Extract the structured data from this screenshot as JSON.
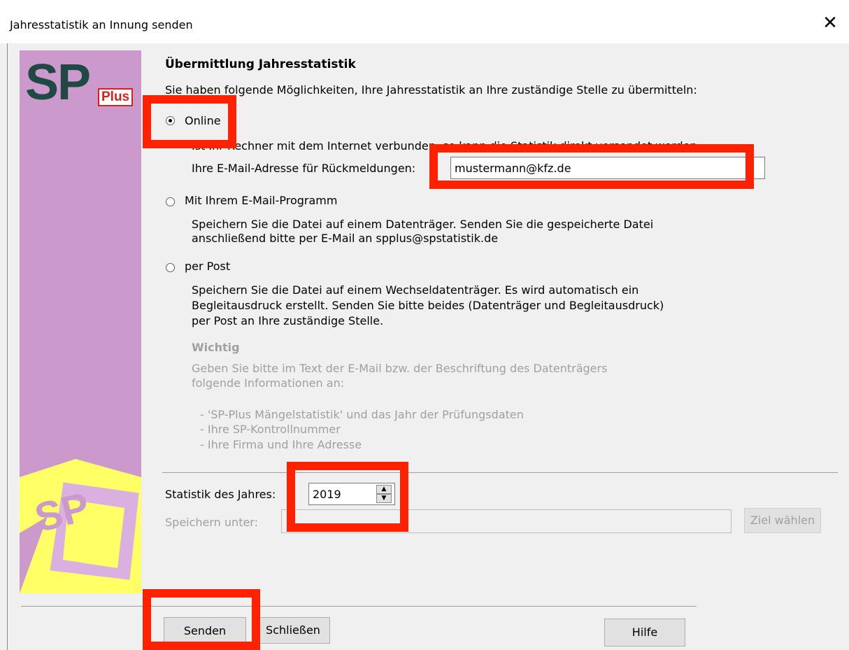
{
  "window": {
    "title": "Jahresstatistik an Innung senden",
    "close": "✕"
  },
  "logo": {
    "sp": "SP",
    "plus": "Plus",
    "small": "SP"
  },
  "heading": "Übermittlung Jahresstatistik",
  "intro": "Sie haben folgende Möglichkeiten, Ihre Jahresstatistik an Ihre zuständige Stelle zu übermitteln:",
  "options": {
    "online": {
      "label": "Online",
      "desc": "Ist Ihr Rechner mit dem Internet verbunden, so kann die Statistik direkt versendet werden",
      "email_label": "Ihre E-Mail-Adresse für Rückmeldungen:",
      "email_value": "mustermann@kfz.de",
      "selected": true
    },
    "mail": {
      "label": "Mit Ihrem E-Mail-Programm",
      "desc1": "Speichern Sie die Datei auf einem Datenträger. Senden Sie die  gespeicherte Datei",
      "desc2": "anschließend bitte per E-Mail an spplus@spstatistik.de"
    },
    "post": {
      "label": "per Post",
      "desc1": "Speichern Sie die Datei auf einem Wechseldatenträger. Es wird   automatisch ein",
      "desc2": "Begleitausdruck erstellt. Senden Sie bitte beides (Datenträger und  Begleitausdruck)",
      "desc3": "per Post an Ihre zuständige Stelle."
    }
  },
  "important": {
    "title": "Wichtig",
    "line1": "Geben Sie bitte im Text der E-Mail bzw. der Beschriftung des Datenträgers",
    "line2": "folgende Informationen an:",
    "item1": "- 'SP-Plus Mängelstatistik' und das Jahr der Prüfungsdaten",
    "item2": "- Ihre SP-Kontrollnummer",
    "item3": "- Ihre Firma und Ihre Adresse"
  },
  "year": {
    "label": "Statistik des Jahres:",
    "value": "2019"
  },
  "save": {
    "label": "Speichern unter:",
    "value": "",
    "button": "Ziel wählen"
  },
  "buttons": {
    "send": "Senden",
    "close": "Schließen",
    "help": "Hilfe"
  }
}
